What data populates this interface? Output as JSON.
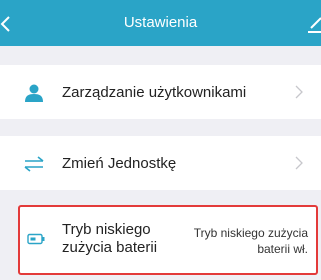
{
  "header": {
    "title": "Ustawienia",
    "back_icon": "chevron-left-icon",
    "edit_icon": "edit-icon",
    "color": "#2aa4c7"
  },
  "settings": {
    "users": {
      "label": "Zarządzanie użytkownikami",
      "icon": "user-icon"
    },
    "units": {
      "label": "Zmień Jednostkę",
      "icon": "swap-arrows-icon"
    },
    "battery": {
      "label": "Tryb niskiego zużycia baterii",
      "status": "Tryb niskiego zużycia baterii wł.",
      "icon": "battery-icon",
      "highlight_color": "#e33a3a"
    }
  },
  "accent_color": "#2aa4c7"
}
